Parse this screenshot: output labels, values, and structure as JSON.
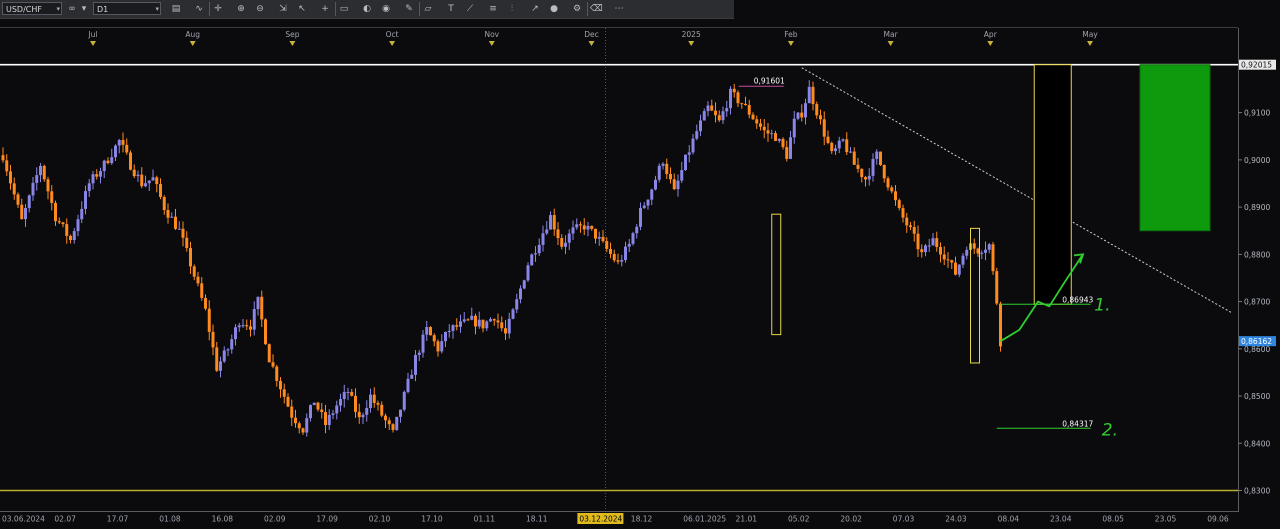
{
  "toolbar": {
    "symbol": "USD/CHF",
    "timeframe": "D1",
    "icons": [
      "link-icon",
      "chart-type-icon",
      "indicator-icon",
      "crosshair-icon",
      "zoom-in-icon",
      "zoom-out-icon",
      "fit-icon",
      "cursor-icon",
      "plus-icon",
      "template-icon",
      "palette-icon",
      "globe-icon",
      "pencil-icon",
      "shapes-icon",
      "text-icon",
      "line-icon",
      "channel-icon",
      "fib-icon",
      "trend-icon",
      "circle-icon",
      "settings-icon",
      "eraser-icon",
      "more-icon"
    ]
  },
  "colors": {
    "background": "#0b0b0d",
    "bull": "#8a86e8",
    "bear": "#ff8a1e",
    "resistance": "#ffffff",
    "support": "#b7ad2e",
    "target_box": "#0d9a0d",
    "annotation": "#2fcf2f",
    "rect_outline": "#e6d84a",
    "last_price": "#2f86e0"
  },
  "chart_data": {
    "type": "candlestick",
    "symbol": "USD/CHF",
    "timeframe": "D1",
    "ylim": [
      0.826,
      0.927
    ],
    "y_ticks": [
      "0,8300",
      "0,8400",
      "0,8500",
      "0,8600",
      "0,8700",
      "0,8800",
      "0,8900",
      "0,9000",
      "0,9100",
      "0,9201"
    ],
    "top_months": [
      "Jul",
      "Aug",
      "Sep",
      "Oct",
      "Nov",
      "Dec",
      "2025",
      "Feb",
      "Mar",
      "Apr",
      "May"
    ],
    "bottom_dates": [
      "03.06.2024",
      "02.07",
      "17.07",
      "01.08",
      "16.08",
      "02.09",
      "17.09",
      "02.10",
      "17.10",
      "01.11",
      "18.11",
      "03.12.2024",
      "18.12",
      "06.01.2025",
      "21.01",
      "05.02",
      "20.02",
      "07.03",
      "24.03",
      "08.04",
      "23.04",
      "08.05",
      "23.05",
      "09.06"
    ],
    "highlight_date": "03.12.2024",
    "price_labels": {
      "resistance": "0,92015",
      "last": "0,86162",
      "high": "0,91601",
      "level1": "0,86943",
      "level2": "0,84317"
    },
    "annotations": [
      "1.",
      "2."
    ],
    "series_path": [
      {
        "t": 0,
        "v": 0.901
      },
      {
        "t": 5,
        "v": 0.887
      },
      {
        "t": 10,
        "v": 0.899
      },
      {
        "t": 14,
        "v": 0.888
      },
      {
        "t": 18,
        "v": 0.883
      },
      {
        "t": 23,
        "v": 0.895
      },
      {
        "t": 27,
        "v": 0.899
      },
      {
        "t": 31,
        "v": 0.904
      },
      {
        "t": 34,
        "v": 0.899
      },
      {
        "t": 37,
        "v": 0.895
      },
      {
        "t": 40,
        "v": 0.896
      },
      {
        "t": 43,
        "v": 0.89
      },
      {
        "t": 47,
        "v": 0.885
      },
      {
        "t": 50,
        "v": 0.878
      },
      {
        "t": 54,
        "v": 0.868
      },
      {
        "t": 57,
        "v": 0.856
      },
      {
        "t": 60,
        "v": 0.86
      },
      {
        "t": 63,
        "v": 0.866
      },
      {
        "t": 66,
        "v": 0.865
      },
      {
        "t": 68,
        "v": 0.87
      },
      {
        "t": 71,
        "v": 0.858
      },
      {
        "t": 74,
        "v": 0.852
      },
      {
        "t": 77,
        "v": 0.846
      },
      {
        "t": 80,
        "v": 0.843
      },
      {
        "t": 83,
        "v": 0.849
      },
      {
        "t": 86,
        "v": 0.844
      },
      {
        "t": 89,
        "v": 0.848
      },
      {
        "t": 92,
        "v": 0.851
      },
      {
        "t": 95,
        "v": 0.845
      },
      {
        "t": 98,
        "v": 0.85
      },
      {
        "t": 101,
        "v": 0.846
      },
      {
        "t": 104,
        "v": 0.842
      },
      {
        "t": 107,
        "v": 0.85
      },
      {
        "t": 110,
        "v": 0.858
      },
      {
        "t": 113,
        "v": 0.864
      },
      {
        "t": 116,
        "v": 0.86
      },
      {
        "t": 119,
        "v": 0.864
      },
      {
        "t": 122,
        "v": 0.865
      },
      {
        "t": 125,
        "v": 0.866
      },
      {
        "t": 128,
        "v": 0.865
      },
      {
        "t": 131,
        "v": 0.867
      },
      {
        "t": 134,
        "v": 0.863
      },
      {
        "t": 137,
        "v": 0.87
      },
      {
        "t": 140,
        "v": 0.878
      },
      {
        "t": 143,
        "v": 0.883
      },
      {
        "t": 146,
        "v": 0.888
      },
      {
        "t": 149,
        "v": 0.882
      },
      {
        "t": 152,
        "v": 0.885
      },
      {
        "t": 155,
        "v": 0.886
      },
      {
        "t": 158,
        "v": 0.884
      },
      {
        "t": 161,
        "v": 0.881
      },
      {
        "t": 164,
        "v": 0.878
      },
      {
        "t": 167,
        "v": 0.882
      },
      {
        "t": 170,
        "v": 0.889
      },
      {
        "t": 173,
        "v": 0.894
      },
      {
        "t": 176,
        "v": 0.9
      },
      {
        "t": 179,
        "v": 0.893
      },
      {
        "t": 182,
        "v": 0.9
      },
      {
        "t": 185,
        "v": 0.906
      },
      {
        "t": 188,
        "v": 0.911
      },
      {
        "t": 191,
        "v": 0.908
      },
      {
        "t": 194,
        "v": 0.914
      },
      {
        "t": 197,
        "v": 0.912
      },
      {
        "t": 200,
        "v": 0.909
      },
      {
        "t": 203,
        "v": 0.906
      },
      {
        "t": 206,
        "v": 0.905
      },
      {
        "t": 209,
        "v": 0.901
      },
      {
        "t": 211,
        "v": 0.908
      },
      {
        "t": 213,
        "v": 0.91
      },
      {
        "t": 215,
        "v": 0.915
      },
      {
        "t": 218,
        "v": 0.908
      },
      {
        "t": 221,
        "v": 0.901
      },
      {
        "t": 224,
        "v": 0.904
      },
      {
        "t": 227,
        "v": 0.899
      },
      {
        "t": 230,
        "v": 0.896
      },
      {
        "t": 233,
        "v": 0.901
      },
      {
        "t": 236,
        "v": 0.895
      },
      {
        "t": 239,
        "v": 0.889
      },
      {
        "t": 242,
        "v": 0.885
      },
      {
        "t": 245,
        "v": 0.88
      },
      {
        "t": 248,
        "v": 0.883
      },
      {
        "t": 251,
        "v": 0.88
      },
      {
        "t": 254,
        "v": 0.876
      },
      {
        "t": 257,
        "v": 0.882
      },
      {
        "t": 260,
        "v": 0.881
      },
      {
        "t": 263,
        "v": 0.882
      },
      {
        "t": 265,
        "v": 0.87
      },
      {
        "t": 266,
        "v": 0.8616
      }
    ],
    "projection": [
      {
        "t": 266,
        "v": 0.8616
      },
      {
        "t": 271,
        "v": 0.864
      },
      {
        "t": 276,
        "v": 0.87
      },
      {
        "t": 279,
        "v": 0.869
      },
      {
        "t": 283,
        "v": 0.874
      },
      {
        "t": 288,
        "v": 0.88
      }
    ]
  }
}
